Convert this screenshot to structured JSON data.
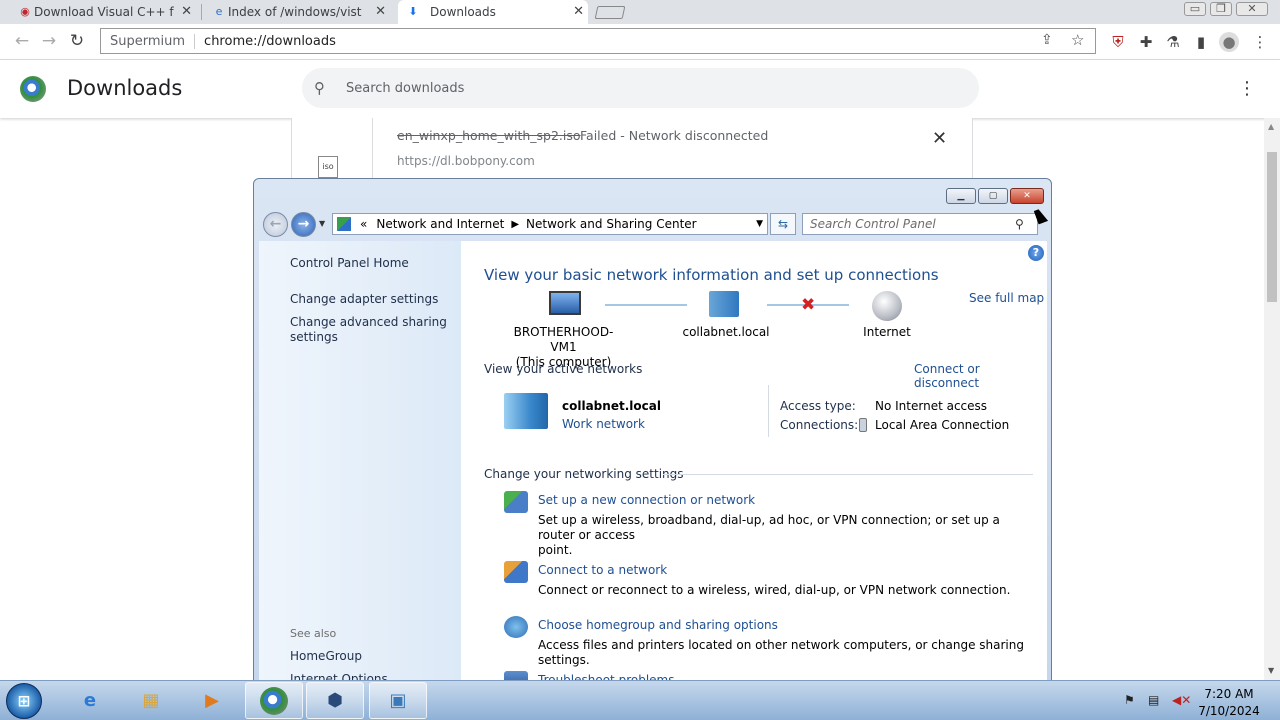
{
  "browser": {
    "tabs": [
      {
        "title": "Download Visual C++ f",
        "icon": "opera-icon"
      },
      {
        "title": "Index of /windows/vist",
        "icon": "ie-page-icon"
      },
      {
        "title": "Downloads",
        "icon": "download-icon"
      }
    ],
    "omnibox": {
      "chip": "Supermium",
      "url": "chrome://downloads"
    }
  },
  "downloads_page": {
    "title": "Downloads",
    "search_placeholder": "Search downloads",
    "item": {
      "filename": "en_winxp_home_with_sp2.iso",
      "status": "Failed - Network disconnected",
      "url": "https://dl.bobpony.com",
      "file_label": "iso"
    }
  },
  "control_panel": {
    "breadcrumb": [
      "«",
      "Network and Internet",
      "Network and Sharing Center"
    ],
    "search_placeholder": "Search Control Panel",
    "left_nav": {
      "home": "Control Panel Home",
      "adapter": "Change adapter settings",
      "advanced_line1": "Change advanced sharing",
      "advanced_line2": "settings",
      "see_also": "See also",
      "homegroup": "HomeGroup",
      "internet_options": "Internet Options"
    },
    "heading": "View your basic network information and set up connections",
    "see_full_map": "See full map",
    "map": {
      "computer_name": "BROTHERHOOD-VM1",
      "computer_sub": "(This computer)",
      "domain": "collabnet.local",
      "internet": "Internet"
    },
    "active_networks": {
      "title": "View your active networks",
      "connect_link": "Connect or disconnect",
      "network_name": "collabnet.local",
      "network_type": "Work network",
      "access_type_label": "Access type:",
      "access_type_value": "No Internet access",
      "connections_label": "Connections:",
      "connections_value": "Local Area Connection"
    },
    "settings": {
      "title": "Change your networking settings",
      "tasks": [
        {
          "link": "Set up a new connection or network",
          "desc_line1": "Set up a wireless, broadband, dial-up, ad hoc, or VPN connection; or set up a router or access",
          "desc_line2": "point."
        },
        {
          "link": "Connect to a network",
          "desc_line1": "Connect or reconnect to a wireless, wired, dial-up, or VPN network connection."
        },
        {
          "link": "Choose homegroup and sharing options",
          "desc_line1": "Access files and printers located on other network computers, or change sharing settings."
        },
        {
          "link": "Troubleshoot problems"
        }
      ]
    }
  },
  "taskbar": {
    "start": "⊞",
    "time": "7:20 AM",
    "date": "7/10/2024"
  },
  "colors": {
    "link": "#1f4f91",
    "error_x": "#d42020",
    "taskbar": "#a9c4e2"
  }
}
